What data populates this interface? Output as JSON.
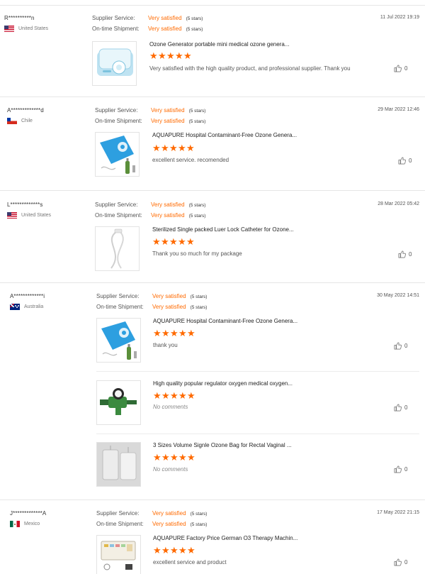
{
  "labels": {
    "supplier_service": "Supplier Service:",
    "ontime_shipment": "On-time Shipment:",
    "very_satisfied": "Very satisfied",
    "five_stars": "(5 stars)"
  },
  "colors": {
    "accent": "#ff6a00",
    "divider": "#e6e6e6"
  },
  "reviews": [
    {
      "buyer": "R**********n",
      "country": "United States",
      "flag": "us-flag-icon",
      "date": "11 Jul 2022 19:19",
      "products": [
        {
          "title": "Ozone Generator portable mini medical ozone genera...",
          "rating": 5,
          "text": "Very satisfied with the high quality product, and professional supplier. Thank you",
          "likes": "0"
        }
      ]
    },
    {
      "buyer": "A*************d",
      "country": "Chile",
      "flag": "chile-flag-icon",
      "date": "29 Mar 2022 12:46",
      "products": [
        {
          "title": "AQUAPURE Hospital Contaminant-Free Ozone Genera...",
          "rating": 5,
          "text": "excellent service. recomended",
          "likes": "0"
        }
      ]
    },
    {
      "buyer": "L*************s",
      "country": "United States",
      "flag": "us-flag-icon",
      "date": "28 Mar 2022 05:42",
      "products": [
        {
          "title": "Sterilized Single packed Luer Lock Catheter for Ozone...",
          "rating": 5,
          "text": "Thank you so much for my package",
          "likes": "0"
        }
      ]
    },
    {
      "buyer": "A*************i",
      "country": "Australia",
      "flag": "australia-flag-icon",
      "date": "30 May 2022 14:51",
      "products": [
        {
          "title": "AQUAPURE Hospital Contaminant-Free Ozone Genera...",
          "rating": 5,
          "text": "thank you",
          "likes": "0"
        },
        {
          "title": "High quality popular regulator oxygen medical oxygen...",
          "rating": 5,
          "text": "No comments",
          "likes": "0"
        },
        {
          "title": "3 Sizes Volume Signle Ozone Bag for Rectal Vaginal ...",
          "rating": 5,
          "text": "No comments",
          "likes": "0"
        }
      ]
    },
    {
      "buyer": "J*************A",
      "country": "Mexico",
      "flag": "mexico-flag-icon",
      "date": "17 May 2022 21:15",
      "products": [
        {
          "title": "AQUAPURE Factory Price German O3 Therapy Machin...",
          "rating": 5,
          "text": "excellent service and product",
          "likes": "0"
        }
      ]
    }
  ]
}
